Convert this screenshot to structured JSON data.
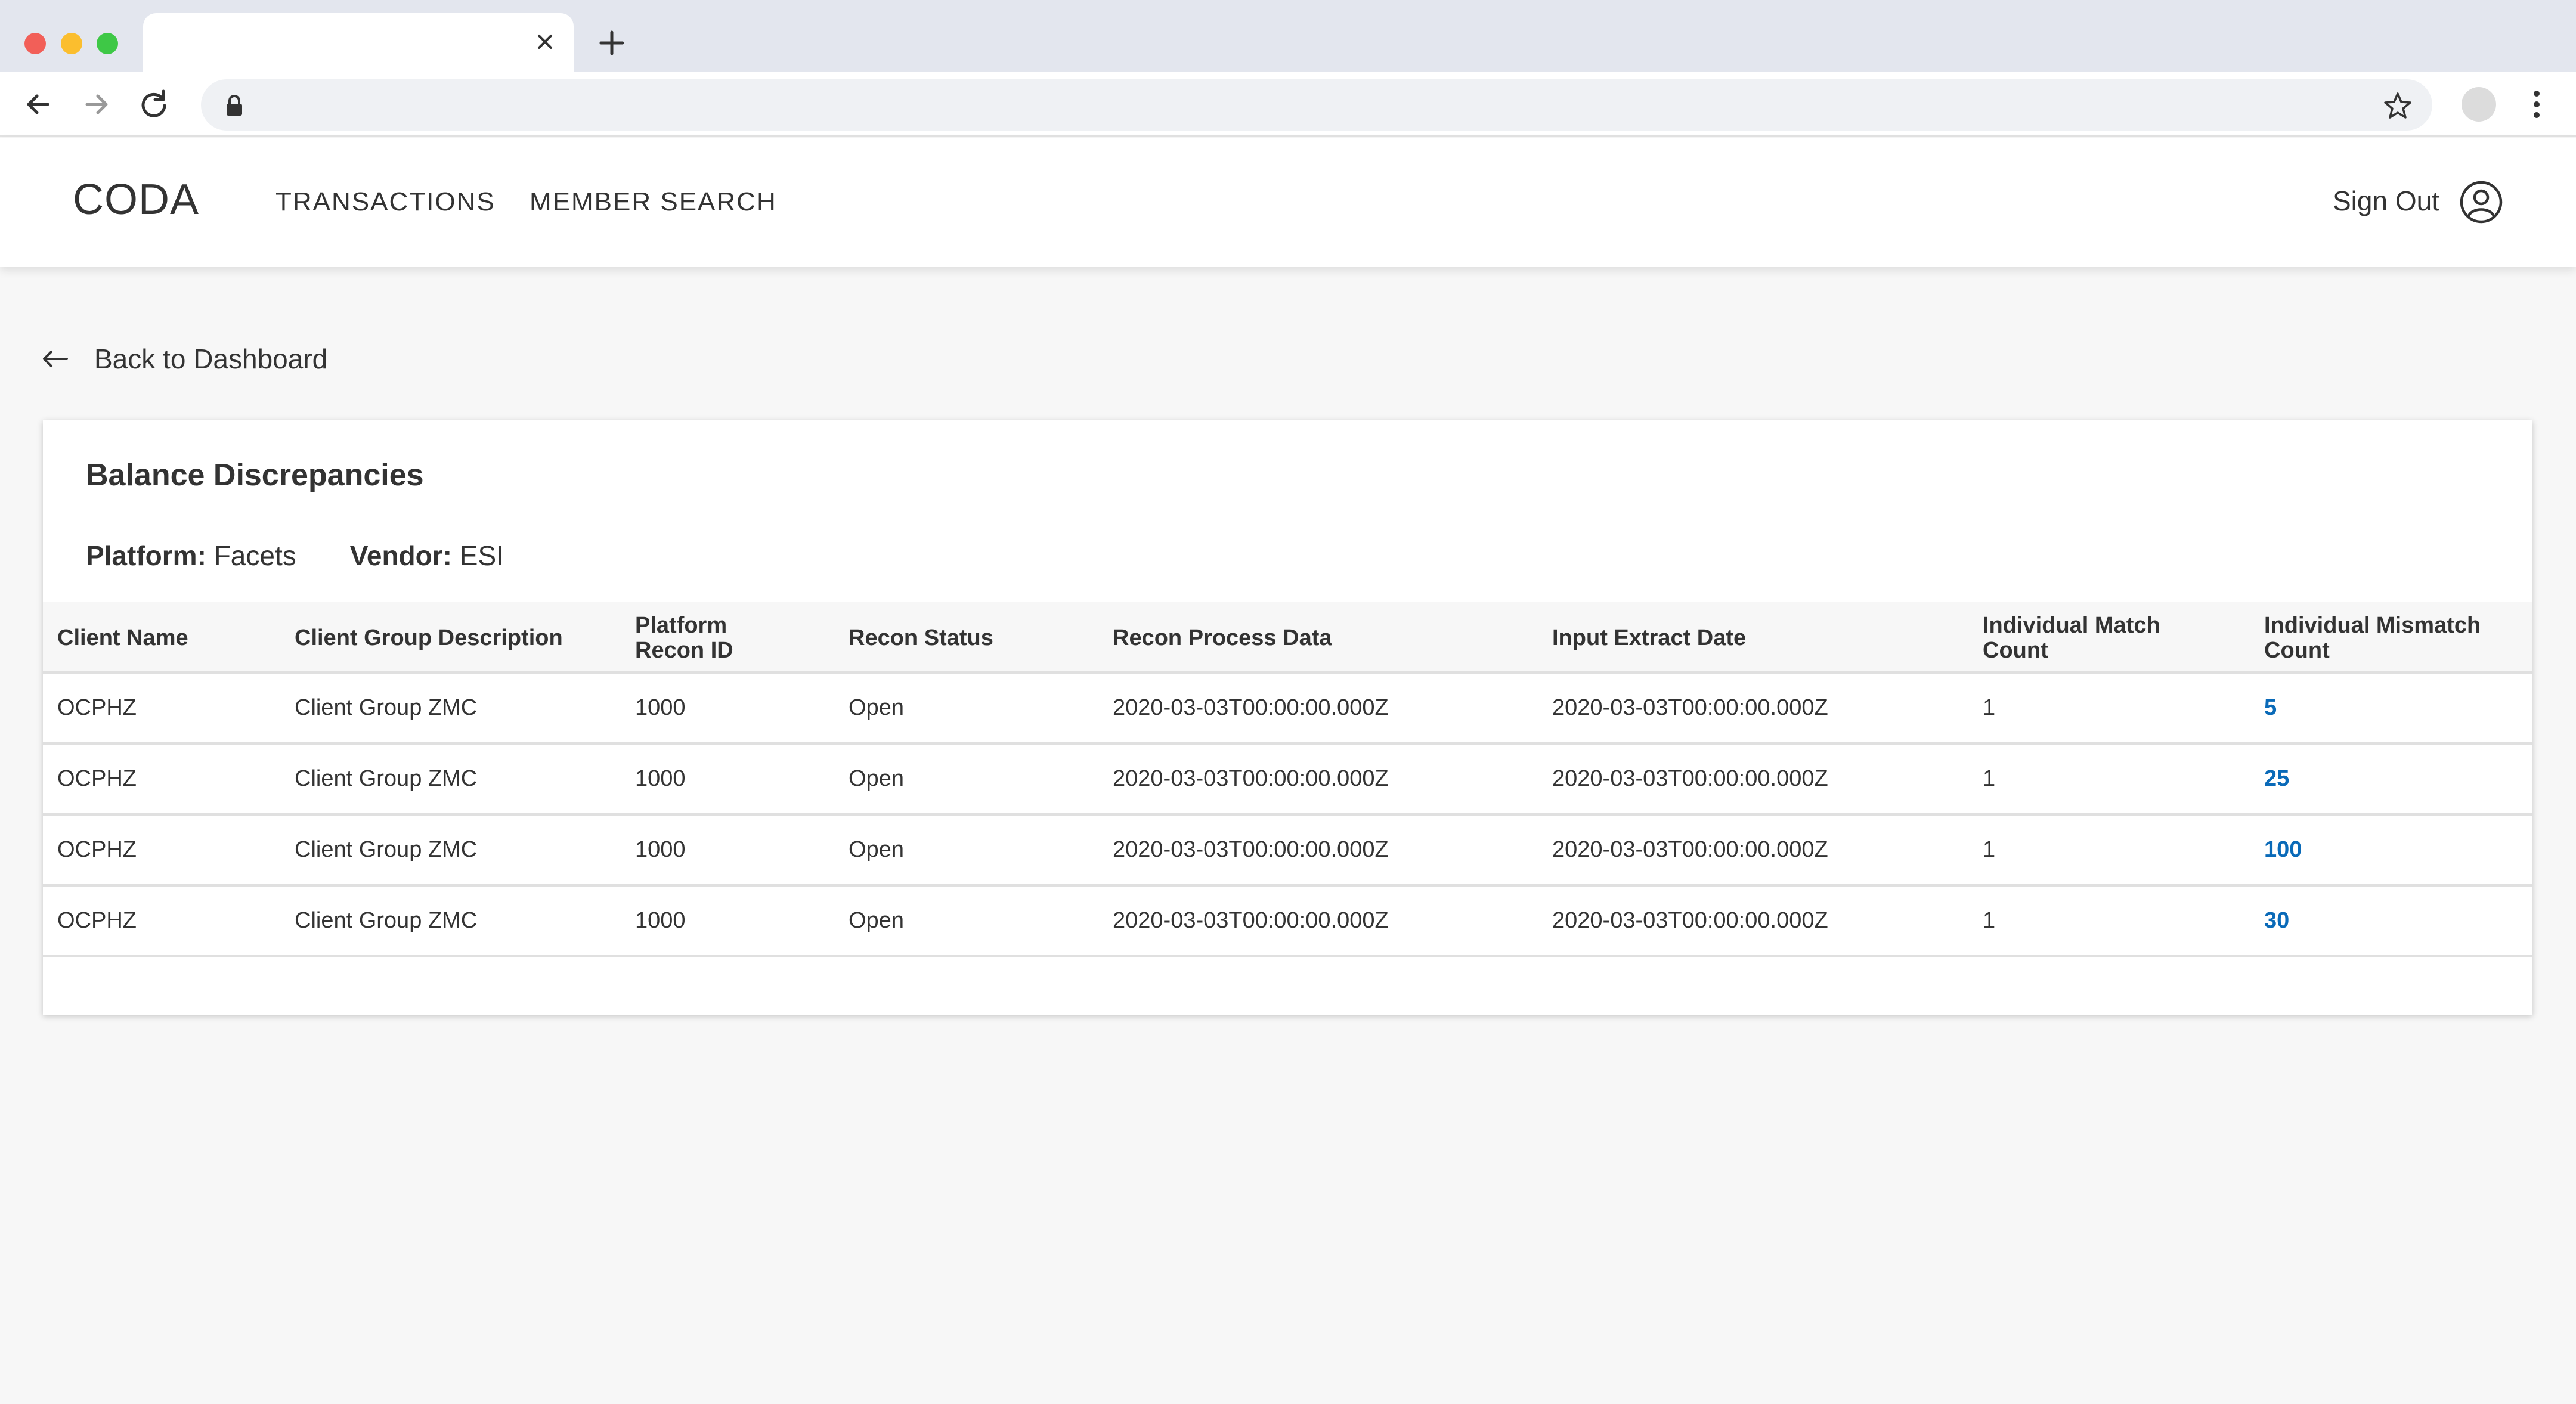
{
  "browser": {
    "tab_title": "",
    "address": ""
  },
  "header": {
    "brand": "CODA",
    "nav": [
      {
        "label": "TRANSACTIONS"
      },
      {
        "label": "MEMBER SEARCH"
      }
    ],
    "signout_label": "Sign Out"
  },
  "back_link": {
    "label": "Back to Dashboard"
  },
  "card": {
    "title": "Balance Discrepancies",
    "platform_label": "Platform:",
    "platform_value": "Facets",
    "vendor_label": "Vendor:",
    "vendor_value": "ESI"
  },
  "table": {
    "columns": [
      "Client Name",
      "Client Group Description",
      "Platform Recon ID",
      "Recon Status",
      "Recon Process Data",
      "Input Extract Date",
      "Individual Match Count",
      "Individual Mismatch Count"
    ],
    "rows": [
      {
        "client_name": "OCPHZ",
        "group": "Client Group ZMC",
        "recon_id": "1000",
        "status": "Open",
        "process": "2020-03-03T00:00:00.000Z",
        "extract": "2020-03-03T00:00:00.000Z",
        "match": "1",
        "mismatch": "5"
      },
      {
        "client_name": "OCPHZ",
        "group": "Client Group ZMC",
        "recon_id": "1000",
        "status": "Open",
        "process": "2020-03-03T00:00:00.000Z",
        "extract": "2020-03-03T00:00:00.000Z",
        "match": "1",
        "mismatch": "25"
      },
      {
        "client_name": "OCPHZ",
        "group": "Client Group ZMC",
        "recon_id": "1000",
        "status": "Open",
        "process": "2020-03-03T00:00:00.000Z",
        "extract": "2020-03-03T00:00:00.000Z",
        "match": "1",
        "mismatch": "100"
      },
      {
        "client_name": "OCPHZ",
        "group": "Client Group ZMC",
        "recon_id": "1000",
        "status": "Open",
        "process": "2020-03-03T00:00:00.000Z",
        "extract": "2020-03-03T00:00:00.000Z",
        "match": "1",
        "mismatch": "30"
      }
    ]
  },
  "colors": {
    "link": "#0a6ab8",
    "page_bg": "#f7f7f7",
    "chrome_bg": "#e3e6ee"
  }
}
